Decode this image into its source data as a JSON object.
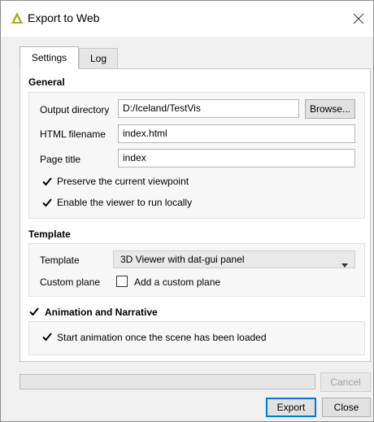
{
  "window": {
    "title": "Export to Web"
  },
  "tabs": [
    {
      "label": "Settings",
      "active": true
    },
    {
      "label": "Log",
      "active": false
    }
  ],
  "general": {
    "title": "General",
    "output_directory": {
      "label": "Output directory",
      "value": "D:/Iceland/TestVis",
      "browse_label": "Browse..."
    },
    "html_filename": {
      "label": "HTML filename",
      "value": "index.html"
    },
    "page_title": {
      "label": "Page title",
      "value": "index"
    },
    "preserve_viewpoint": {
      "label": "Preserve the current viewpoint",
      "checked": true
    },
    "run_locally": {
      "label": "Enable the viewer to run locally",
      "checked": true
    }
  },
  "template": {
    "title": "Template",
    "template_label": "Template",
    "template_value": "3D Viewer with dat-gui panel",
    "custom_plane_label": "Custom plane",
    "add_custom_plane": {
      "label": "Add a custom plane",
      "checked": false
    }
  },
  "animation": {
    "title": "Animation and Narrative",
    "enabled": true,
    "start_on_load": {
      "label": "Start animation once the scene has been loaded",
      "checked": true
    }
  },
  "progress": {
    "fraction": 0
  },
  "buttons": {
    "cancel": "Cancel",
    "export": "Export",
    "close": "Close"
  },
  "colors": {
    "accent": "#0078d7",
    "progress": "#06b025"
  }
}
